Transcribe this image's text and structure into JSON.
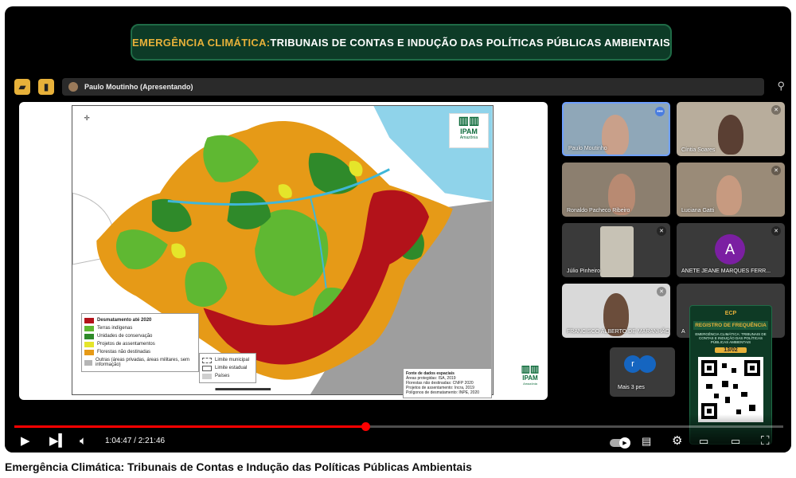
{
  "banner": {
    "accent": "EMERGÊNCIA CLIMÁTICA:",
    "rest": " TRIBUNAIS DE CONTAS E INDUÇÃO DAS POLÍTICAS PÚBLICAS AMBIENTAIS"
  },
  "meeting": {
    "presenter": "Paulo Moutinho (Apresentando)"
  },
  "slide": {
    "logo": "IPAM",
    "logo_sub": "Amazônia",
    "legend_left": [
      {
        "label": "Desmatamento até 2020",
        "color": "#b3121a"
      },
      {
        "label": "Terras indígenas",
        "color": "#5fb832"
      },
      {
        "label": "Unidades de conservação",
        "color": "#2f8a2a"
      },
      {
        "label": "Projetos de assentamentos",
        "color": "#e5e52a"
      },
      {
        "label": "Florestas não destinadas",
        "color": "#e69a17"
      },
      {
        "label": "Outras (áreas privadas, áreas militares, sem informação)",
        "color": "#b5b5b5"
      }
    ],
    "legend_right": [
      "Limite municipal",
      "Limite estadual",
      "Países"
    ],
    "sources": [
      "Fonte de dados espaciais",
      "Áreas protegidas: ISA, 2019",
      "Florestas não destinadas: CNFP 2020",
      "Projetos de assentamento: Incra, 2019",
      "Polígonos de desmatamento: INPE, 2020"
    ]
  },
  "participants": [
    {
      "name": "Paulo Moutinho"
    },
    {
      "name": "Cíntia Soares"
    },
    {
      "name": "Ronaldo Pacheco Ribeiro"
    },
    {
      "name": "Luciana Gatti"
    },
    {
      "name": "Júlio Pinheiro"
    },
    {
      "name": "ANETE JEANE MARQUES FERR...",
      "initial": "A"
    },
    {
      "name": "FRANCISCO ALBERTO DE MARANHÃO"
    },
    {
      "name": "A"
    }
  ],
  "more_people": "Mais 3 pes",
  "certificate": {
    "badge": "ECP",
    "title": "REGISTRO DE FREQUÊNCIA",
    "subtitle": "EMERGÊNCIA CLIMÁTICA: TRIBUNAIS DE CONTAS E INDUÇÃO DAS POLÍTICAS PÚBLICAS AMBIENTAIS",
    "date": "13/02"
  },
  "player": {
    "current_time": "1:04:47",
    "duration": "2:21:46",
    "time_label": "1:04:47 / 2:21:46",
    "progress": 0.457
  },
  "video_title": "Emergência Climática: Tribunais de Contas e Indução das Políticas Públicas Ambientais",
  "colors": {
    "accent": "#e7b13a",
    "banner_bg": "#0d3b27",
    "progress": "#ff0000",
    "purple_avatar": "#7b1fa2"
  }
}
